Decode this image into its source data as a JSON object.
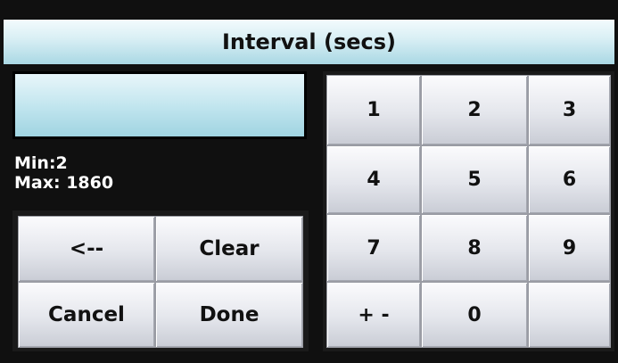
{
  "title": "Interval (secs)",
  "display": {
    "value": ""
  },
  "range": {
    "min": "Min:2",
    "max": "Max: 1860"
  },
  "actions": {
    "backspace": "<--",
    "clear": "Clear",
    "cancel": "Cancel",
    "done": "Done"
  },
  "keypad": {
    "k1": "1",
    "k2": "2",
    "k3": "3",
    "k4": "4",
    "k5": "5",
    "k6": "6",
    "k7": "7",
    "k8": "8",
    "k9": "9",
    "sign": "+ -",
    "k0": "0"
  }
}
